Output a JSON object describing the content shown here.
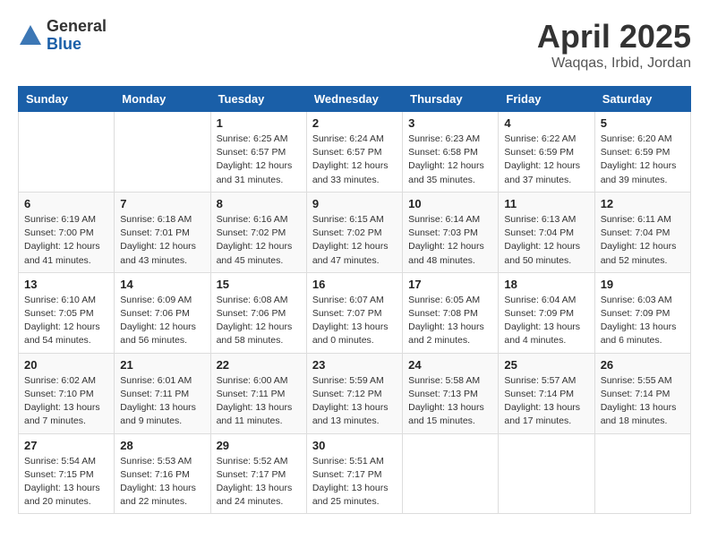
{
  "header": {
    "logo_general": "General",
    "logo_blue": "Blue",
    "title": "April 2025",
    "subtitle": "Waqqas, Irbid, Jordan"
  },
  "weekdays": [
    "Sunday",
    "Monday",
    "Tuesday",
    "Wednesday",
    "Thursday",
    "Friday",
    "Saturday"
  ],
  "weeks": [
    [
      null,
      null,
      {
        "day": "1",
        "sunrise": "Sunrise: 6:25 AM",
        "sunset": "Sunset: 6:57 PM",
        "daylight": "Daylight: 12 hours and 31 minutes."
      },
      {
        "day": "2",
        "sunrise": "Sunrise: 6:24 AM",
        "sunset": "Sunset: 6:57 PM",
        "daylight": "Daylight: 12 hours and 33 minutes."
      },
      {
        "day": "3",
        "sunrise": "Sunrise: 6:23 AM",
        "sunset": "Sunset: 6:58 PM",
        "daylight": "Daylight: 12 hours and 35 minutes."
      },
      {
        "day": "4",
        "sunrise": "Sunrise: 6:22 AM",
        "sunset": "Sunset: 6:59 PM",
        "daylight": "Daylight: 12 hours and 37 minutes."
      },
      {
        "day": "5",
        "sunrise": "Sunrise: 6:20 AM",
        "sunset": "Sunset: 6:59 PM",
        "daylight": "Daylight: 12 hours and 39 minutes."
      }
    ],
    [
      {
        "day": "6",
        "sunrise": "Sunrise: 6:19 AM",
        "sunset": "Sunset: 7:00 PM",
        "daylight": "Daylight: 12 hours and 41 minutes."
      },
      {
        "day": "7",
        "sunrise": "Sunrise: 6:18 AM",
        "sunset": "Sunset: 7:01 PM",
        "daylight": "Daylight: 12 hours and 43 minutes."
      },
      {
        "day": "8",
        "sunrise": "Sunrise: 6:16 AM",
        "sunset": "Sunset: 7:02 PM",
        "daylight": "Daylight: 12 hours and 45 minutes."
      },
      {
        "day": "9",
        "sunrise": "Sunrise: 6:15 AM",
        "sunset": "Sunset: 7:02 PM",
        "daylight": "Daylight: 12 hours and 47 minutes."
      },
      {
        "day": "10",
        "sunrise": "Sunrise: 6:14 AM",
        "sunset": "Sunset: 7:03 PM",
        "daylight": "Daylight: 12 hours and 48 minutes."
      },
      {
        "day": "11",
        "sunrise": "Sunrise: 6:13 AM",
        "sunset": "Sunset: 7:04 PM",
        "daylight": "Daylight: 12 hours and 50 minutes."
      },
      {
        "day": "12",
        "sunrise": "Sunrise: 6:11 AM",
        "sunset": "Sunset: 7:04 PM",
        "daylight": "Daylight: 12 hours and 52 minutes."
      }
    ],
    [
      {
        "day": "13",
        "sunrise": "Sunrise: 6:10 AM",
        "sunset": "Sunset: 7:05 PM",
        "daylight": "Daylight: 12 hours and 54 minutes."
      },
      {
        "day": "14",
        "sunrise": "Sunrise: 6:09 AM",
        "sunset": "Sunset: 7:06 PM",
        "daylight": "Daylight: 12 hours and 56 minutes."
      },
      {
        "day": "15",
        "sunrise": "Sunrise: 6:08 AM",
        "sunset": "Sunset: 7:06 PM",
        "daylight": "Daylight: 12 hours and 58 minutes."
      },
      {
        "day": "16",
        "sunrise": "Sunrise: 6:07 AM",
        "sunset": "Sunset: 7:07 PM",
        "daylight": "Daylight: 13 hours and 0 minutes."
      },
      {
        "day": "17",
        "sunrise": "Sunrise: 6:05 AM",
        "sunset": "Sunset: 7:08 PM",
        "daylight": "Daylight: 13 hours and 2 minutes."
      },
      {
        "day": "18",
        "sunrise": "Sunrise: 6:04 AM",
        "sunset": "Sunset: 7:09 PM",
        "daylight": "Daylight: 13 hours and 4 minutes."
      },
      {
        "day": "19",
        "sunrise": "Sunrise: 6:03 AM",
        "sunset": "Sunset: 7:09 PM",
        "daylight": "Daylight: 13 hours and 6 minutes."
      }
    ],
    [
      {
        "day": "20",
        "sunrise": "Sunrise: 6:02 AM",
        "sunset": "Sunset: 7:10 PM",
        "daylight": "Daylight: 13 hours and 7 minutes."
      },
      {
        "day": "21",
        "sunrise": "Sunrise: 6:01 AM",
        "sunset": "Sunset: 7:11 PM",
        "daylight": "Daylight: 13 hours and 9 minutes."
      },
      {
        "day": "22",
        "sunrise": "Sunrise: 6:00 AM",
        "sunset": "Sunset: 7:11 PM",
        "daylight": "Daylight: 13 hours and 11 minutes."
      },
      {
        "day": "23",
        "sunrise": "Sunrise: 5:59 AM",
        "sunset": "Sunset: 7:12 PM",
        "daylight": "Daylight: 13 hours and 13 minutes."
      },
      {
        "day": "24",
        "sunrise": "Sunrise: 5:58 AM",
        "sunset": "Sunset: 7:13 PM",
        "daylight": "Daylight: 13 hours and 15 minutes."
      },
      {
        "day": "25",
        "sunrise": "Sunrise: 5:57 AM",
        "sunset": "Sunset: 7:14 PM",
        "daylight": "Daylight: 13 hours and 17 minutes."
      },
      {
        "day": "26",
        "sunrise": "Sunrise: 5:55 AM",
        "sunset": "Sunset: 7:14 PM",
        "daylight": "Daylight: 13 hours and 18 minutes."
      }
    ],
    [
      {
        "day": "27",
        "sunrise": "Sunrise: 5:54 AM",
        "sunset": "Sunset: 7:15 PM",
        "daylight": "Daylight: 13 hours and 20 minutes."
      },
      {
        "day": "28",
        "sunrise": "Sunrise: 5:53 AM",
        "sunset": "Sunset: 7:16 PM",
        "daylight": "Daylight: 13 hours and 22 minutes."
      },
      {
        "day": "29",
        "sunrise": "Sunrise: 5:52 AM",
        "sunset": "Sunset: 7:17 PM",
        "daylight": "Daylight: 13 hours and 24 minutes."
      },
      {
        "day": "30",
        "sunrise": "Sunrise: 5:51 AM",
        "sunset": "Sunset: 7:17 PM",
        "daylight": "Daylight: 13 hours and 25 minutes."
      },
      null,
      null,
      null
    ]
  ]
}
